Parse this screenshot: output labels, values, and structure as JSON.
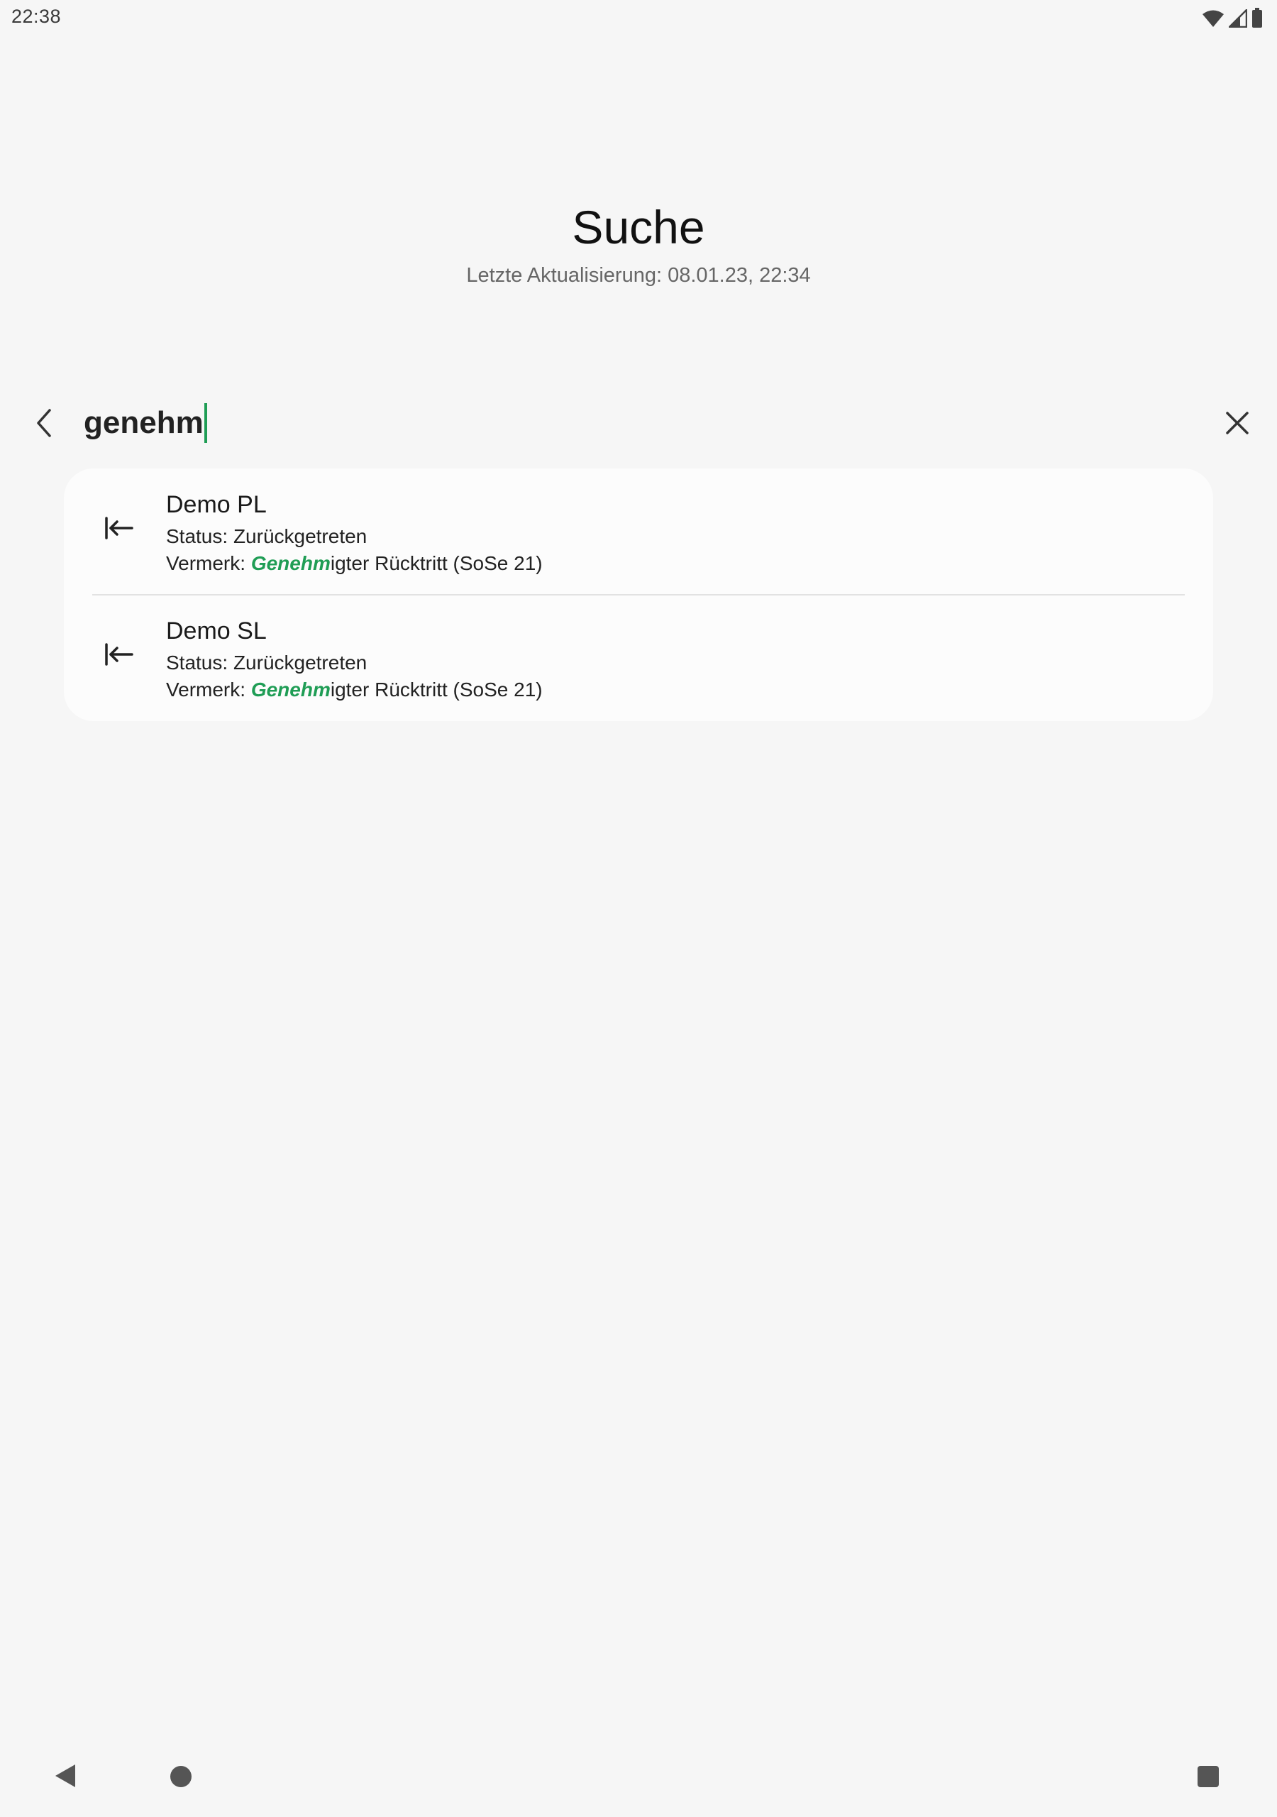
{
  "status_bar": {
    "time": "22:38",
    "icons": [
      "wifi-icon",
      "signal-icon",
      "battery-icon"
    ]
  },
  "header": {
    "title": "Suche",
    "subtitle": "Letzte Aktualisierung: 08.01.23, 22:34"
  },
  "search": {
    "value": "genehm",
    "back_icon": "chevron-left-icon",
    "clear_icon": "close-icon"
  },
  "results": [
    {
      "icon": "withdraw-arrow-icon",
      "title": "Demo PL",
      "status": "Status: Zurückgetreten",
      "note_prefix": "Vermerk: ",
      "note_match": "Genehm",
      "note_rest": "igter Rücktritt (SoSe 21)"
    },
    {
      "icon": "withdraw-arrow-icon",
      "title": "Demo SL",
      "status": "Status: Zurückgetreten",
      "note_prefix": "Vermerk: ",
      "note_match": "Genehm",
      "note_rest": "igter Rücktritt (SoSe 21)"
    }
  ],
  "colors": {
    "accent": "#1f9d55",
    "background": "#f6f6f6",
    "card": "#fcfcfc"
  },
  "nav_bar": {
    "icons": [
      "nav-back-icon",
      "nav-home-icon",
      "nav-recents-icon"
    ]
  }
}
